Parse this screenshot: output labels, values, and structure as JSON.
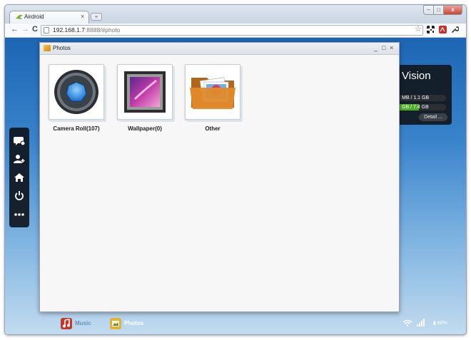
{
  "browser": {
    "tab_title": "Airdroid",
    "tab_close": "×",
    "address_host": "192.168.1.7",
    "address_rest": ":8888/#photo",
    "back_glyph": "←",
    "forward_glyph": "→",
    "reload_glyph": "C",
    "star_glyph": "☆",
    "min_glyph": "–",
    "max_glyph": "□",
    "close_glyph": "x",
    "icons": [
      "airdroid-tab-icon",
      "back-icon",
      "forward-icon",
      "reload-icon",
      "page-icon",
      "bookmark-star-icon",
      "qr-code-extension-icon",
      "pdf-extension-icon",
      "wrench-menu-icon"
    ]
  },
  "widget": {
    "title": "Vision",
    "storage1": "MB / 1.1 GB",
    "storage2_pre": "GB",
    "storage2_post": " / 7.4 GB",
    "storage2_fill": 0.45,
    "detail_label": "Detail ..."
  },
  "sidebar": {
    "items": [
      {
        "name": "messages-icon",
        "glyph": "💬"
      },
      {
        "name": "add-contact-icon",
        "glyph": "👤"
      },
      {
        "name": "home-icon",
        "glyph": "⌂"
      },
      {
        "name": "power-icon",
        "glyph": "⏻"
      },
      {
        "name": "more-icon",
        "glyph": "•••"
      }
    ]
  },
  "photos_window": {
    "title": "Photos",
    "min_glyph": "_",
    "max_glyph": "□",
    "close_glyph": "×",
    "albums": [
      {
        "label": "Camera Roll(107)",
        "icon": "camera-lens-icon"
      },
      {
        "label": "Wallpaper(0)",
        "icon": "picture-frame-icon"
      },
      {
        "label": "Other",
        "icon": "folder-photos-icon"
      }
    ]
  },
  "taskbar": {
    "music_label": "Music",
    "photos_label": "Photos",
    "battery_label": "80%",
    "colors": {
      "music": "#c0392b",
      "photos": "#e0b23b",
      "music_label": "#6b8fb5",
      "photos_label": "#ffffff"
    }
  }
}
